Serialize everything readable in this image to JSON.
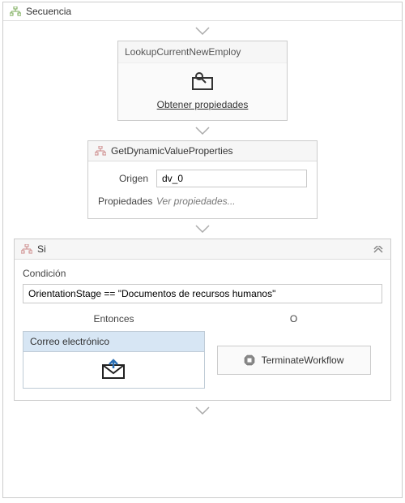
{
  "sequence": {
    "title": "Secuencia"
  },
  "lookup": {
    "title": "LookupCurrentNewEmploy",
    "link": "Obtener propiedades"
  },
  "gdv": {
    "title": "GetDynamicValueProperties",
    "origen_label": "Origen",
    "origen_value": "dv_0",
    "props_label": "Propiedades",
    "props_link": "Ver propiedades..."
  },
  "ifblock": {
    "title": "Si",
    "condition_label": "Condición",
    "condition_value": "OrientationStage == \"Documentos de recursos humanos\"",
    "then_label": "Entonces",
    "else_label": "O",
    "then_card_title": "Correo electrónico",
    "else_card_title": "TerminateWorkflow"
  }
}
